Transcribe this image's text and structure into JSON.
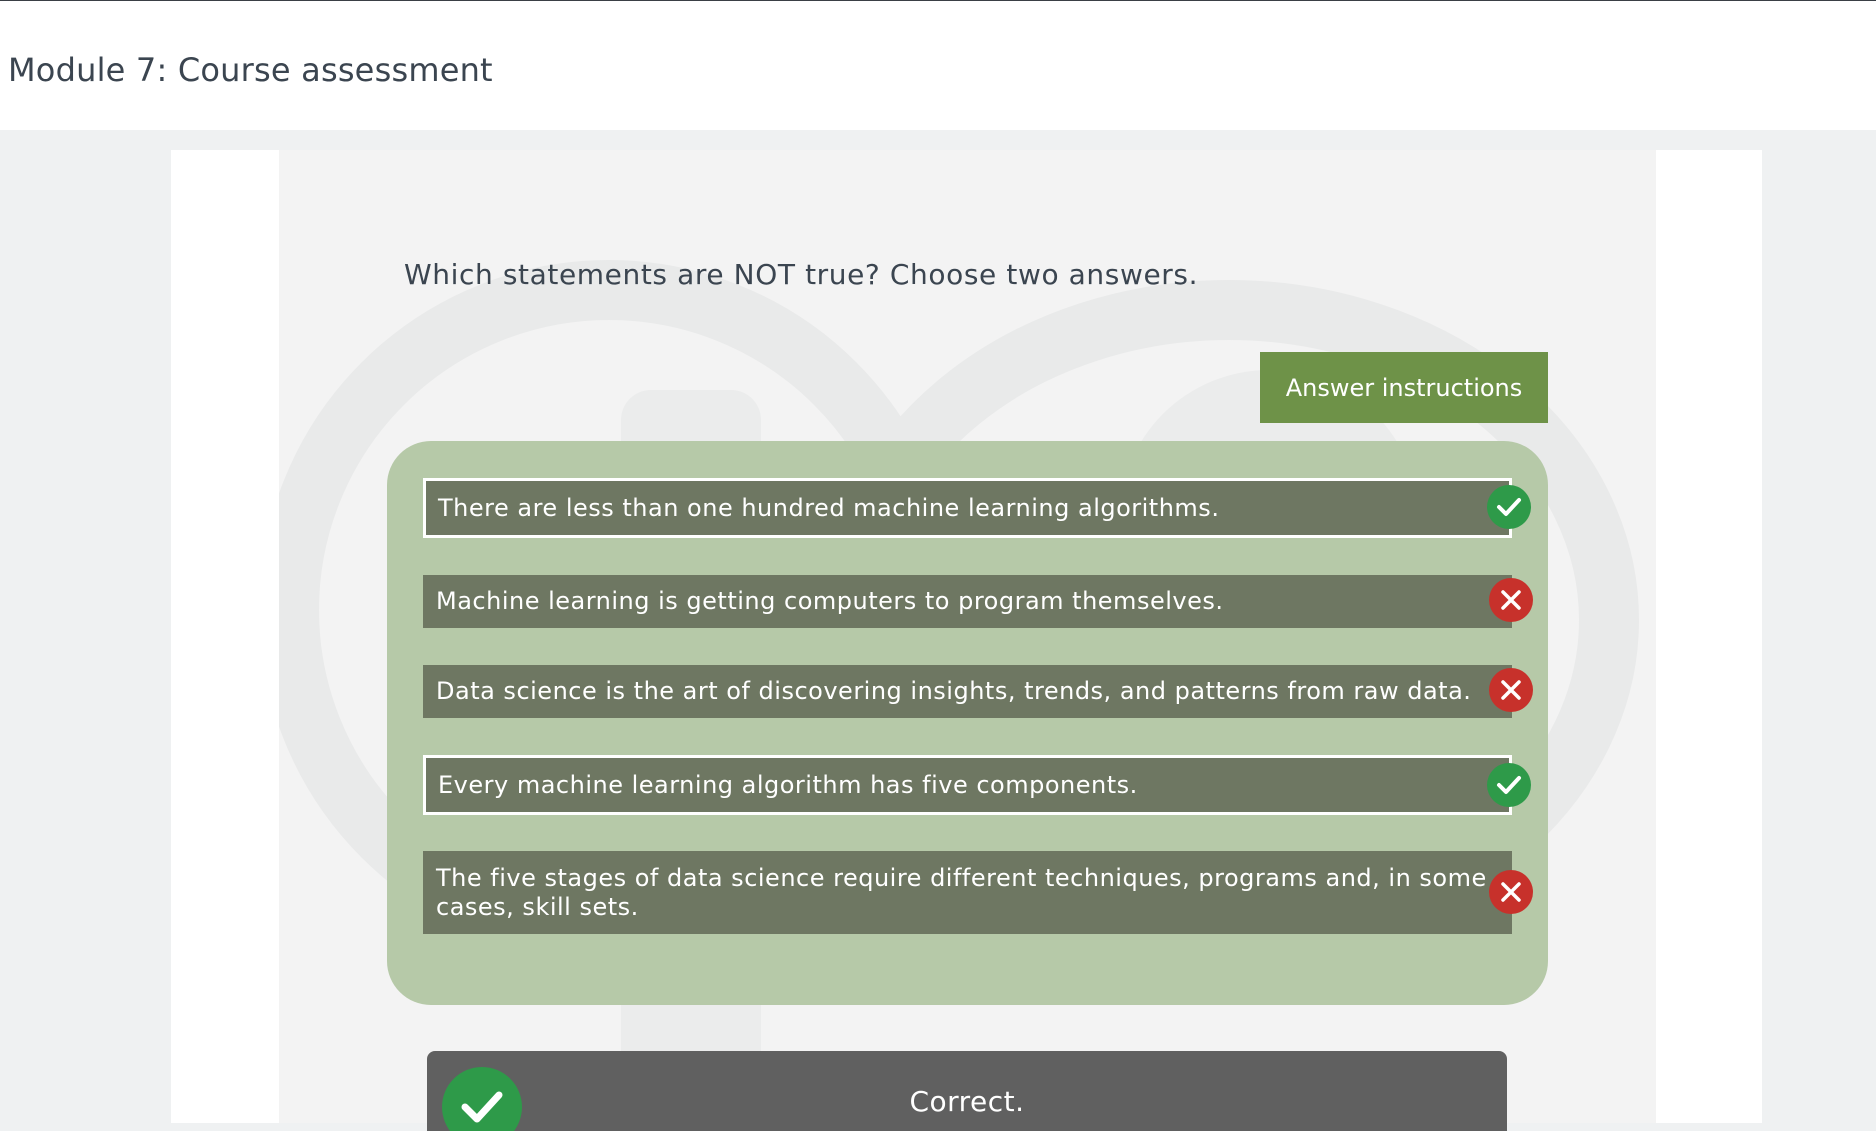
{
  "header": {
    "title": "Module 7: Course assessment"
  },
  "question": {
    "prompt": "Which statements are NOT true? Choose two answers.",
    "instructions_label": "Answer instructions",
    "answers": [
      {
        "text": "There are less than one hundred machine learning algorithms.",
        "selected": true,
        "result": "correct",
        "icon": "check-icon"
      },
      {
        "text": "Machine learning is getting computers to program themselves.",
        "selected": false,
        "result": "incorrect",
        "icon": "x-icon"
      },
      {
        "text": "Data science is the art of discovering insights, trends, and patterns from raw data.",
        "selected": false,
        "result": "incorrect",
        "icon": "x-icon"
      },
      {
        "text": "Every machine learning algorithm has five components.",
        "selected": true,
        "result": "correct",
        "icon": "check-icon"
      },
      {
        "text": "The five stages of data science require different techniques, programs and, in some cases, skill sets.",
        "selected": false,
        "result": "incorrect",
        "icon": "x-icon"
      }
    ]
  },
  "feedback": {
    "text": "Correct.",
    "icon": "check-icon"
  },
  "colors": {
    "accent": "#6e9248",
    "answers_bg": "#b6c9a8",
    "answer_row": "#6e7762",
    "correct": "#2e9a49",
    "incorrect": "#c7312b",
    "feedback_bg": "#606060"
  }
}
